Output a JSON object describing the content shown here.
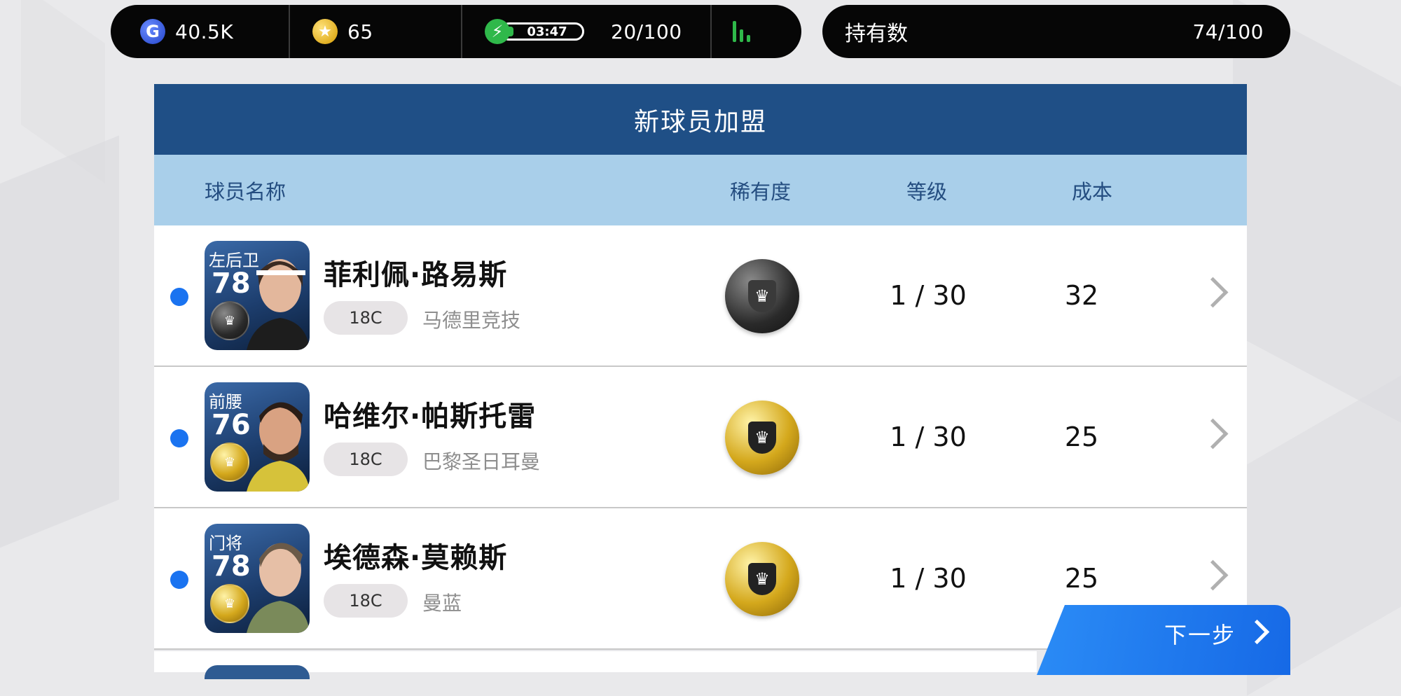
{
  "status_bar": {
    "gp_icon": "g-coin-icon",
    "gp_letter": "G",
    "gp_value": "40.5K",
    "coins_icon": "star-coin-icon",
    "coins_value": "65",
    "energy_icon": "lightning-icon",
    "energy_timer": "03:47",
    "energy_value": "20/100",
    "signal_icon": "signal-bars-icon"
  },
  "holdings": {
    "label": "持有数",
    "value": "74/100"
  },
  "panel": {
    "title": "新球员加盟",
    "columns": {
      "name": "球员名称",
      "rarity": "稀有度",
      "level": "等级",
      "cost": "成本"
    },
    "players": [
      {
        "position": "左后卫",
        "rating": "78",
        "name": "菲利佩·路易斯",
        "season": "18C",
        "club": "马德里竞技",
        "rarity": "black-ball",
        "level": "1 / 30",
        "cost": "32"
      },
      {
        "position": "前腰",
        "rating": "76",
        "name": "哈维尔·帕斯托雷",
        "season": "18C",
        "club": "巴黎圣日耳曼",
        "rarity": "gold-ball",
        "level": "1 / 30",
        "cost": "25"
      },
      {
        "position": "门将",
        "rating": "78",
        "name": "埃德森·莫赖斯",
        "season": "18C",
        "club": "曼蓝",
        "rarity": "gold-ball",
        "level": "1 / 30",
        "cost": "25"
      }
    ]
  },
  "next_button": {
    "label": "下一步",
    "icon": "chevron-right-icon"
  },
  "colors": {
    "header_blue": "#1f4f86",
    "column_header": "#a9cfea",
    "accent_blue": "#1a73f0",
    "energy_green": "#2fb84a"
  }
}
